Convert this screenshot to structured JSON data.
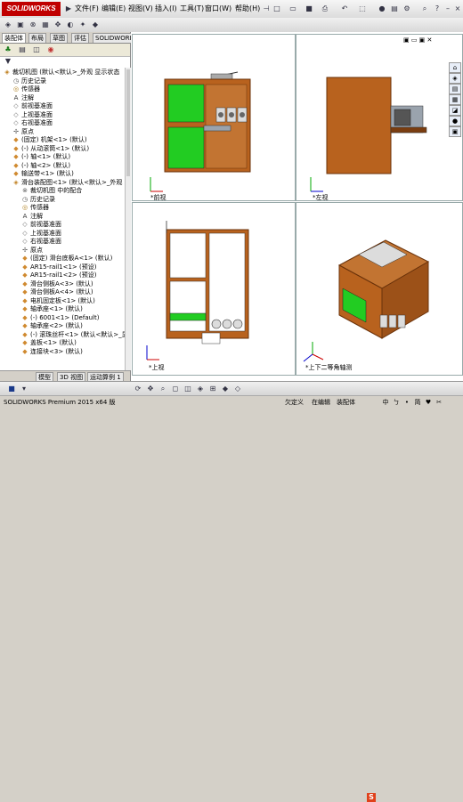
{
  "app": {
    "logo_text": "SOLIDWORKS",
    "menu": [
      "文件(F)",
      "编辑(E)",
      "视图(V)",
      "插入(I)",
      "工具(T)",
      "窗口(W)",
      "帮助(H)"
    ]
  },
  "left_panel": {
    "tabs": [
      "装配体",
      "布局",
      "草图",
      "评估",
      "SOLIDWORKS 插件"
    ],
    "active_tab": "装配体",
    "tree": [
      {
        "label": "裁切机图 (默认<默认>_外观 显示状态",
        "level": 0,
        "icon": "assembly-icon"
      },
      {
        "label": "历史记录",
        "level": 1,
        "icon": "history-icon"
      },
      {
        "label": "传感器",
        "level": 1,
        "icon": "sensor-icon"
      },
      {
        "label": "注解",
        "level": 1,
        "icon": "annotation-icon"
      },
      {
        "label": "前视基准面",
        "level": 1,
        "icon": "plane-icon"
      },
      {
        "label": "上视基准面",
        "level": 1,
        "icon": "plane-icon"
      },
      {
        "label": "右视基准面",
        "level": 1,
        "icon": "plane-icon"
      },
      {
        "label": "原点",
        "level": 1,
        "icon": "origin-icon"
      },
      {
        "label": "(固定) 机架<1> (默认)",
        "level": 1,
        "icon": "part-icon"
      },
      {
        "label": "(-) 从动滚筒<1> (默认)",
        "level": 1,
        "icon": "part-icon"
      },
      {
        "label": "(-) 轴<1> (默认)",
        "level": 1,
        "icon": "part-icon"
      },
      {
        "label": "(-) 轴<2> (默认)",
        "level": 1,
        "icon": "part-icon"
      },
      {
        "label": "输送带<1> (默认)",
        "level": 1,
        "icon": "part-icon"
      },
      {
        "label": "滑台装配图<1> (默认<默认>_外观",
        "level": 1,
        "icon": "assembly-icon"
      },
      {
        "label": "裁切机图 中的配合",
        "level": 2,
        "icon": "mate-icon"
      },
      {
        "label": "历史记录",
        "level": 2,
        "icon": "history-icon"
      },
      {
        "label": "传感器",
        "level": 2,
        "icon": "sensor-icon"
      },
      {
        "label": "注解",
        "level": 2,
        "icon": "annotation-icon"
      },
      {
        "label": "前视基准面",
        "level": 2,
        "icon": "plane-icon"
      },
      {
        "label": "上视基准面",
        "level": 2,
        "icon": "plane-icon"
      },
      {
        "label": "右视基准面",
        "level": 2,
        "icon": "plane-icon"
      },
      {
        "label": "原点",
        "level": 2,
        "icon": "origin-icon"
      },
      {
        "label": "(固定) 滑台底板A<1> (默认)",
        "level": 2,
        "icon": "part-icon"
      },
      {
        "label": "AR15-rail1<1> (预设)",
        "level": 2,
        "icon": "part-icon"
      },
      {
        "label": "AR15-rail1<2> (预设)",
        "level": 2,
        "icon": "part-icon"
      },
      {
        "label": "滑台侧板A<3> (默认)",
        "level": 2,
        "icon": "part-icon"
      },
      {
        "label": "滑台侧板A<4> (默认)",
        "level": 2,
        "icon": "part-icon"
      },
      {
        "label": "电机固定板<1> (默认)",
        "level": 2,
        "icon": "part-icon"
      },
      {
        "label": "轴承座<1> (默认)",
        "level": 2,
        "icon": "part-icon"
      },
      {
        "label": "(-) 6001<1> (Default)",
        "level": 2,
        "icon": "part-icon"
      },
      {
        "label": "轴承座<2> (默认)",
        "level": 2,
        "icon": "part-icon"
      },
      {
        "label": "(-) 滚珠丝杆<1> (默认<默认>_显",
        "level": 2,
        "icon": "part-icon"
      },
      {
        "label": "盖板<1> (默认)",
        "level": 2,
        "icon": "part-icon"
      },
      {
        "label": "连接块<3> (默认)",
        "level": 2,
        "icon": "part-icon"
      }
    ],
    "bottom_tabs": [
      "模型",
      "3D 视图",
      "运动算例 1"
    ]
  },
  "viewports": [
    {
      "label": "*前视"
    },
    {
      "label": "*左视"
    },
    {
      "label": "*上视"
    },
    {
      "label": "*上下二等角轴测"
    }
  ],
  "status": {
    "version": "SOLIDWORKS Premium 2015 x64 版",
    "mode": "欠定义",
    "state": "在编辑",
    "target": "装配体",
    "ime": [
      "中",
      "ㄅ",
      "•",
      "简",
      "♥",
      "✂"
    ]
  },
  "colors": {
    "wood": "#b8621e",
    "wood_dark": "#7a3d10",
    "green": "#22cc22",
    "steel": "#9aa3ad",
    "logo_red": "#c00000",
    "ime_s": "#e0401a"
  }
}
